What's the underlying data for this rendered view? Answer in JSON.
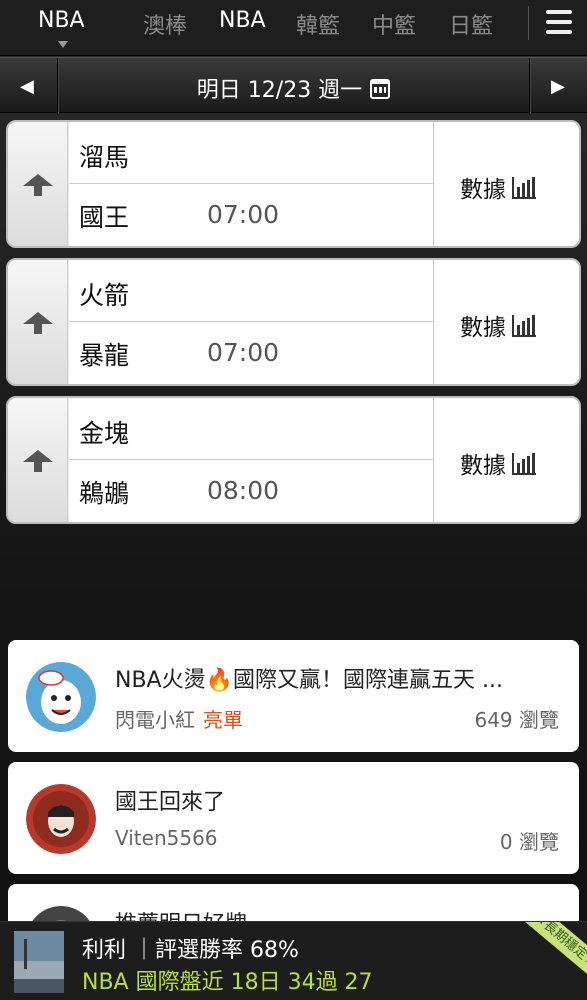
{
  "nav": {
    "tabs": [
      {
        "label": "NBA"
      },
      {
        "label": "澳棒"
      },
      {
        "label": "NBA"
      },
      {
        "label": "韓籃"
      },
      {
        "label": "中籃"
      },
      {
        "label": "日籃"
      }
    ]
  },
  "datebar": {
    "date": "明日 12/23 週一"
  },
  "games": [
    {
      "home": "溜馬",
      "away": "國王",
      "time": "07:00",
      "stats_label": "數據"
    },
    {
      "home": "火箭",
      "away": "暴龍",
      "time": "07:00",
      "stats_label": "數據"
    },
    {
      "home": "金塊",
      "away": "鵜鶘",
      "time": "08:00",
      "stats_label": "數據"
    }
  ],
  "posts": [
    {
      "title": "NBA火燙🔥國際又贏！國際連贏五天 ...",
      "author": "閃電小紅",
      "tag": "亮單",
      "views": "649 瀏覽"
    },
    {
      "title": "國王回來了",
      "author": "Viten5566",
      "tag": "",
      "views": "0 瀏覽"
    },
    {
      "title": "推薦明日好牌",
      "author": "",
      "tag": "",
      "views": ""
    }
  ],
  "bottom": {
    "line1": "利利 ｜評選勝率 68%",
    "line2": "NBA 國際盤近 18日 34過 27",
    "ribbon": "★長期穩定★"
  }
}
